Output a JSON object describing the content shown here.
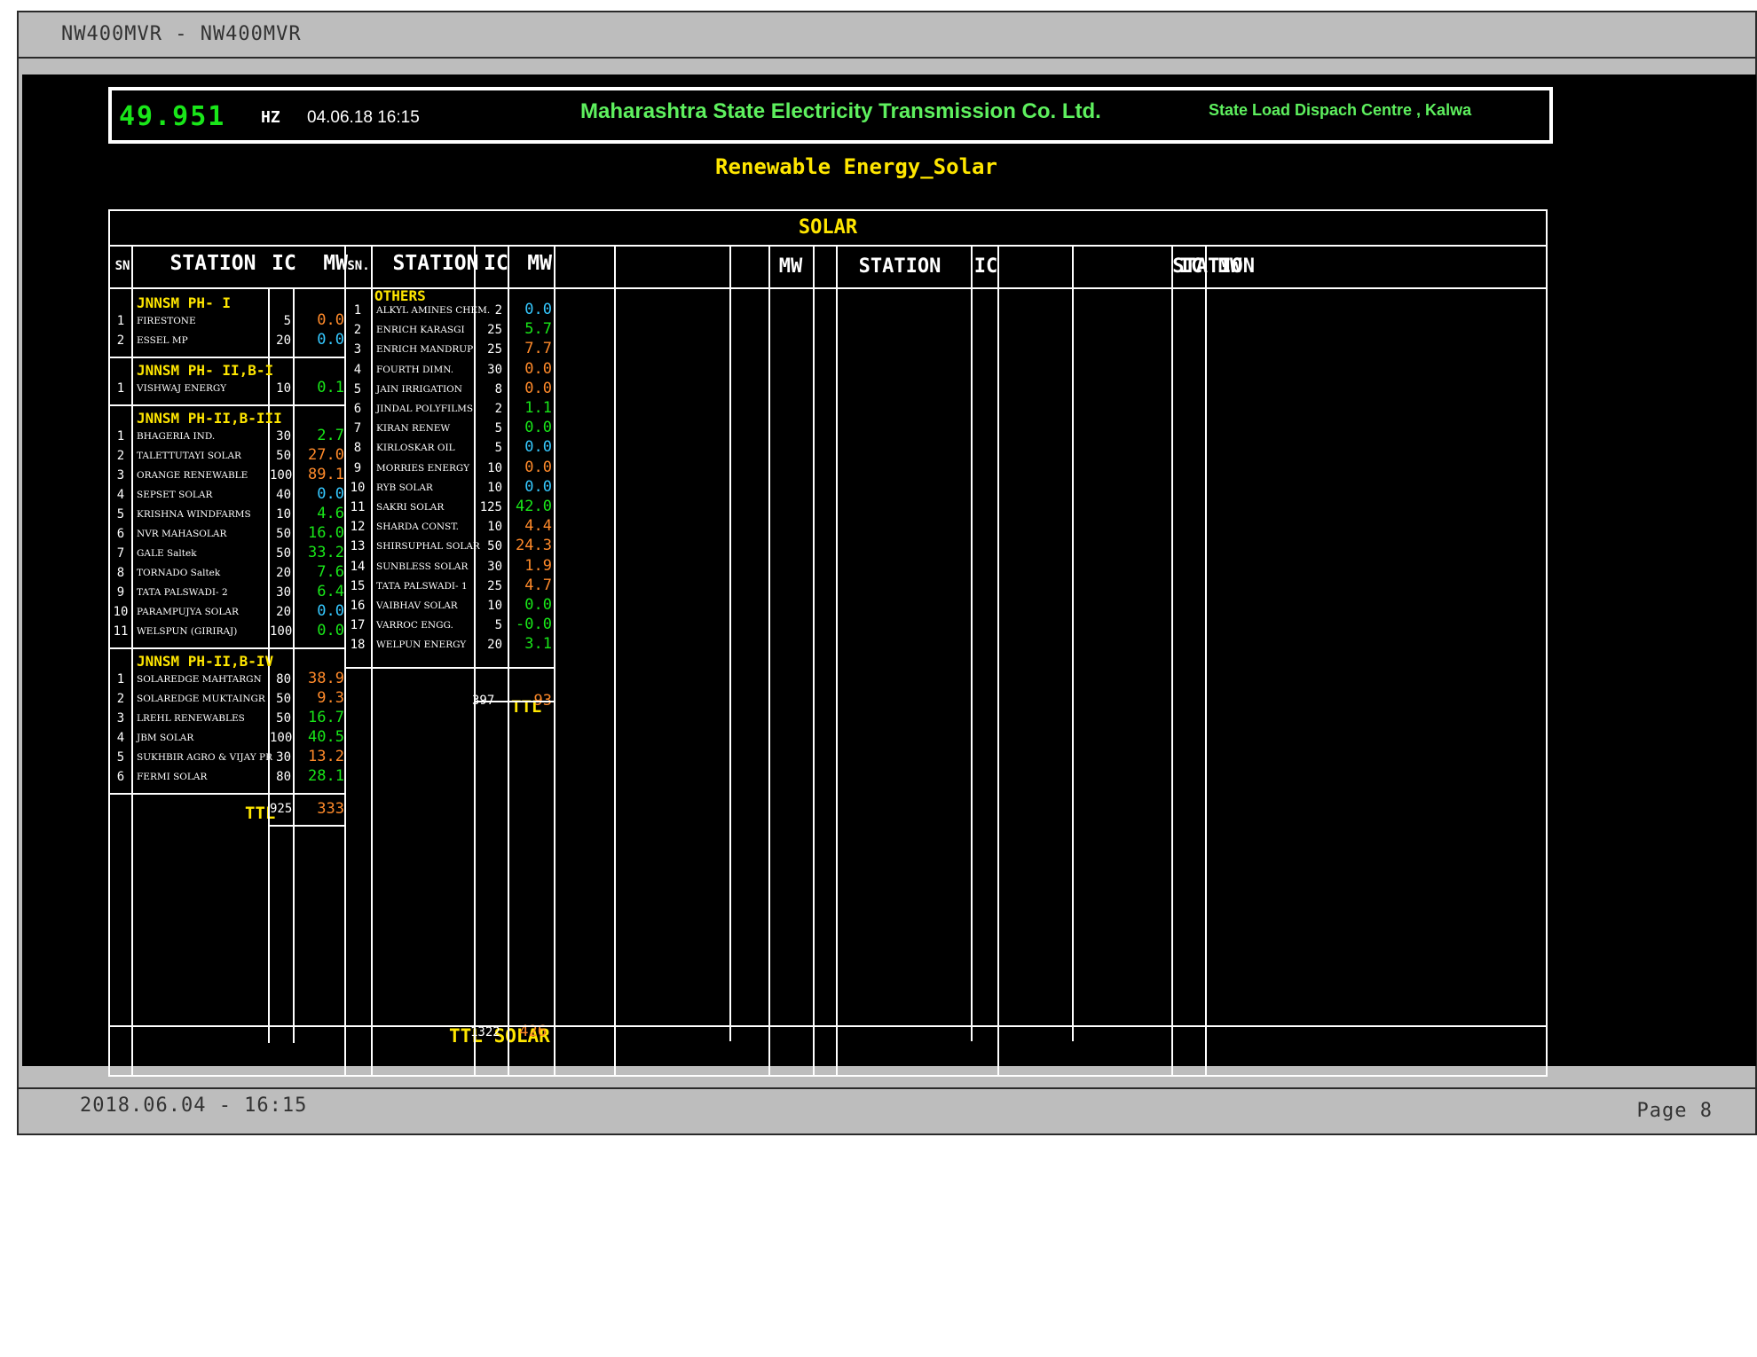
{
  "window": {
    "title": "NW400MVR - NW400MVR",
    "footer_timestamp": "2018.06.04 - 16:15",
    "footer_page": "Page 8"
  },
  "header": {
    "frequency": "49.951",
    "frequency_unit": "HZ",
    "datetime": "04.06.18  16:15",
    "company": "Maharashtra State Electricity Transmission Co. Ltd.",
    "centre": "State Load Dispach Centre , Kalwa"
  },
  "page_title": "Renewable Energy_Solar",
  "section_title": "SOLAR",
  "colors": {
    "green": "#19e619",
    "orange": "#ff8a2a",
    "cyan": "#35c8ff",
    "yellow": "#ffe600",
    "white": "#ffffff"
  },
  "columns": {
    "left": {
      "sn": "SN",
      "station": "STATION",
      "ic": "IC",
      "mw": "MW"
    },
    "mid": {
      "sn": "SN.",
      "station": "STATION",
      "ic": "IC",
      "mw": "MW"
    },
    "right": {
      "mw1": "MW",
      "station1": "STATION",
      "ic1": "IC",
      "station2": "STATION",
      "ic2": "IC",
      "mw2": "MW"
    }
  },
  "left_groups": [
    {
      "name": "JNNSM PH- I",
      "rows": [
        {
          "sn": "1",
          "station": "FIRESTONE",
          "ic": "5",
          "mw": "0.0",
          "color": "orange"
        },
        {
          "sn": "2",
          "station": "ESSEL MP",
          "ic": "20",
          "mw": "0.0",
          "color": "cyan"
        }
      ]
    },
    {
      "name": "JNNSM PH- II,B-I",
      "rows": [
        {
          "sn": "1",
          "station": "VISHWAJ ENERGY",
          "ic": "10",
          "mw": "0.1",
          "color": "green"
        }
      ]
    },
    {
      "name": "JNNSM PH-II,B-III",
      "rows": [
        {
          "sn": "1",
          "station": "BHAGERIA IND.",
          "ic": "30",
          "mw": "2.7",
          "color": "green"
        },
        {
          "sn": "2",
          "station": "TALETTUTAYI SOLAR",
          "ic": "50",
          "mw": "27.0",
          "color": "orange"
        },
        {
          "sn": "3",
          "station": "ORANGE RENEWABLE",
          "ic": "100",
          "mw": "89.1",
          "color": "orange"
        },
        {
          "sn": "4",
          "station": "SEPSET SOLAR",
          "ic": "40",
          "mw": "0.0",
          "color": "cyan"
        },
        {
          "sn": "5",
          "station": "KRISHNA WINDFARMS",
          "ic": "10",
          "mw": "4.6",
          "color": "green"
        },
        {
          "sn": "6",
          "station": "NVR MAHASOLAR",
          "ic": "50",
          "mw": "16.0",
          "color": "green"
        },
        {
          "sn": "7",
          "station": "GALE Saltek",
          "ic": "50",
          "mw": "33.2",
          "color": "green"
        },
        {
          "sn": "8",
          "station": "TORNADO Saltek",
          "ic": "20",
          "mw": "7.6",
          "color": "green"
        },
        {
          "sn": "9",
          "station": "TATA PALSWADI- 2",
          "ic": "30",
          "mw": "6.4",
          "color": "green"
        },
        {
          "sn": "10",
          "station": "PARAMPUJYA SOLAR",
          "ic": "20",
          "mw": "0.0",
          "color": "cyan"
        },
        {
          "sn": "11",
          "station": "WELSPUN (GIRIRAJ)",
          "ic": "100",
          "mw": "0.0",
          "color": "green"
        }
      ]
    },
    {
      "name": "JNNSM PH-II,B-IV",
      "rows": [
        {
          "sn": "1",
          "station": "SOLAREDGE MAHTARGN",
          "ic": "80",
          "mw": "38.9",
          "color": "orange"
        },
        {
          "sn": "2",
          "station": "SOLAREDGE MUKTAINGR",
          "ic": "50",
          "mw": "9.3",
          "color": "orange"
        },
        {
          "sn": "3",
          "station": "LREHL RENEWABLES",
          "ic": "50",
          "mw": "16.7",
          "color": "green"
        },
        {
          "sn": "4",
          "station": "JBM SOLAR",
          "ic": "100",
          "mw": "40.5",
          "color": "green"
        },
        {
          "sn": "5",
          "station": "SUKHBIR AGRO & VIJAY PR",
          "ic": "30",
          "mw": "13.2",
          "color": "orange"
        },
        {
          "sn": "6",
          "station": "FERMI SOLAR",
          "ic": "80",
          "mw": "28.1",
          "color": "green"
        }
      ]
    }
  ],
  "left_total": {
    "label": "TTL",
    "ic": "925",
    "mw": "333"
  },
  "mid_group": {
    "name": "OTHERS",
    "rows": [
      {
        "sn": "1",
        "station": "ALKYL AMINES CHEM.",
        "ic": "2",
        "mw": "0.0",
        "color": "cyan"
      },
      {
        "sn": "2",
        "station": "ENRICH KARASGI",
        "ic": "25",
        "mw": "5.7",
        "color": "green"
      },
      {
        "sn": "3",
        "station": "ENRICH MANDRUP",
        "ic": "25",
        "mw": "7.7",
        "color": "orange"
      },
      {
        "sn": "4",
        "station": "FOURTH DIMN.",
        "ic": "30",
        "mw": "0.0",
        "color": "orange"
      },
      {
        "sn": "5",
        "station": "JAIN IRRIGATION",
        "ic": "8",
        "mw": "0.0",
        "color": "orange"
      },
      {
        "sn": "6",
        "station": "JINDAL POLYFILMS",
        "ic": "2",
        "mw": "1.1",
        "color": "green"
      },
      {
        "sn": "7",
        "station": "KIRAN RENEW",
        "ic": "5",
        "mw": "0.0",
        "color": "green"
      },
      {
        "sn": "8",
        "station": "KIRLOSKAR OIL",
        "ic": "5",
        "mw": "0.0",
        "color": "cyan"
      },
      {
        "sn": "9",
        "station": "MORRIES ENERGY",
        "ic": "10",
        "mw": "0.0",
        "color": "orange"
      },
      {
        "sn": "10",
        "station": "RYB SOLAR",
        "ic": "10",
        "mw": "0.0",
        "color": "cyan"
      },
      {
        "sn": "11",
        "station": "SAKRI SOLAR",
        "ic": "125",
        "mw": "42.0",
        "color": "green"
      },
      {
        "sn": "12",
        "station": "SHARDA CONST.",
        "ic": "10",
        "mw": "4.4",
        "color": "orange"
      },
      {
        "sn": "13",
        "station": "SHIRSUPHAL SOLAR",
        "ic": "50",
        "mw": "24.3",
        "color": "orange"
      },
      {
        "sn": "14",
        "station": "SUNBLESS SOLAR",
        "ic": "30",
        "mw": "1.9",
        "color": "orange"
      },
      {
        "sn": "15",
        "station": "TATA PALSWADI- 1",
        "ic": "25",
        "mw": "4.7",
        "color": "orange"
      },
      {
        "sn": "16",
        "station": "VAIBHAV SOLAR",
        "ic": "10",
        "mw": "0.0",
        "color": "green"
      },
      {
        "sn": "17",
        "station": "VARROC ENGG.",
        "ic": "5",
        "mw": "-0.0",
        "color": "green"
      },
      {
        "sn": "18",
        "station": "WELPUN ENERGY",
        "ic": "20",
        "mw": "3.1",
        "color": "green"
      }
    ]
  },
  "mid_total": {
    "label": "TTL",
    "ic": "397",
    "mw": "93"
  },
  "grand_total": {
    "label": "TTL SOLAR",
    "ic": "1322",
    "mw": "426"
  }
}
